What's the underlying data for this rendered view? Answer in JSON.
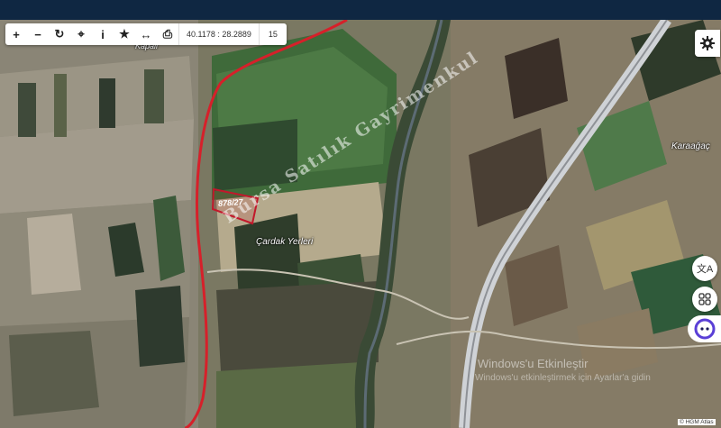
{
  "toolbar": {
    "buttons": [
      {
        "name": "zoom-in-button",
        "icon": "plus-icon",
        "glyph": "+"
      },
      {
        "name": "zoom-out-button",
        "icon": "minus-icon",
        "glyph": "−"
      },
      {
        "name": "refresh-button",
        "icon": "refresh-icon",
        "glyph": "↻"
      },
      {
        "name": "locate-button",
        "icon": "crosshair-icon",
        "glyph": "⌖"
      },
      {
        "name": "info-button",
        "icon": "info-icon",
        "glyph": "i"
      },
      {
        "name": "favorite-button",
        "icon": "star-icon",
        "glyph": "★"
      },
      {
        "name": "measure-button",
        "icon": "ruler-arrows-icon",
        "glyph": "↔"
      },
      {
        "name": "print-button",
        "icon": "printer-icon",
        "glyph": "⎙"
      }
    ],
    "coordinates": "40.1178 : 28.2889",
    "zoom_level": "15"
  },
  "labels": {
    "top_partial": "Kapali",
    "village": "Çardak Yerleri",
    "town": "Karaağaç",
    "parcel": "878/27"
  },
  "watermark": "Bursa Satılık Gayrimenkul",
  "windows_notice": {
    "title": "Windows'u Etkinleştir",
    "subtitle": "Windows'u etkinleştirmek için Ayarlar'a gidin"
  },
  "attribution": "© HGM Atlas",
  "colors": {
    "topbar": "#0f2742",
    "boundary_line": "#d6202a",
    "parcel_outline": "#c2182b"
  }
}
